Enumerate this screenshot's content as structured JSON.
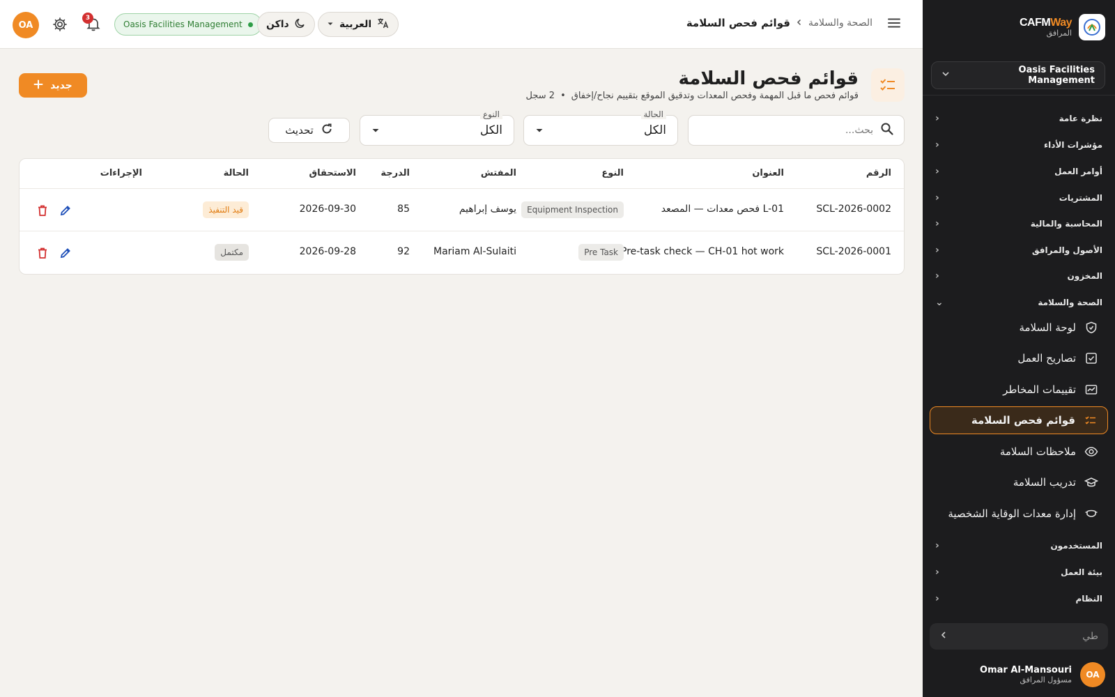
{
  "topbar": {
    "avatar_initials": "OA",
    "notif_count": "3",
    "org_name": "Oasis Facilities Management",
    "theme_label": "داكن",
    "language_label": "العربية",
    "breadcrumb_parent": "الصحة والسلامة",
    "breadcrumb_current": "قوائم فحص السلامة"
  },
  "sidebar": {
    "brand_main": "CAFM",
    "brand_accent": "Way",
    "brand_sub": "المرافق",
    "org_selector": "Oasis Facilities Management",
    "sections": [
      {
        "label": "نظرة عامة"
      },
      {
        "label": "مؤشرات الأداء"
      },
      {
        "label": "أوامر العمل"
      },
      {
        "label": "المشتريات"
      },
      {
        "label": "المحاسبة والمالية"
      },
      {
        "label": "الأصول والمرافق"
      },
      {
        "label": "المخزون"
      },
      {
        "label": "الصحة والسلامة"
      }
    ],
    "hse_items": [
      {
        "label": "لوحة السلامة",
        "icon": "shield-icon"
      },
      {
        "label": "تصاريح العمل",
        "icon": "checkbox-icon"
      },
      {
        "label": "تقييمات المخاطر",
        "icon": "chart-box-icon"
      },
      {
        "label": "قوائم فحص السلامة",
        "icon": "checklist-icon"
      },
      {
        "label": "ملاحظات السلامة",
        "icon": "eye-icon"
      },
      {
        "label": "تدريب السلامة",
        "icon": "graduation-cap-icon"
      },
      {
        "label": "إدارة معدات الوقاية الشخصية",
        "icon": "mask-icon"
      }
    ],
    "lower_sections": [
      {
        "label": "المستخدمون"
      },
      {
        "label": "بيئة العمل"
      },
      {
        "label": "النظام"
      }
    ],
    "search_placeholder": "طي",
    "user_name": "Omar Al-Mansouri",
    "user_role": "مسؤول المرافق",
    "user_initials": "OA"
  },
  "page": {
    "title": "قوائم فحص السلامة",
    "subtitle": "قوائم فحص ما قبل المهمة وفحص المعدات وتدقيق الموقع بتقييم نجاح/إخفاق",
    "record_count": "2 سجل",
    "new_button": "جديد"
  },
  "filters": {
    "search_placeholder": "بحث...",
    "status_label": "الحالة",
    "status_value": "الكل",
    "type_label": "النوع",
    "type_value": "الكل",
    "refresh_label": "تحديث"
  },
  "table": {
    "headers": {
      "number": "الرقم",
      "title": "العنوان",
      "type": "النوع",
      "inspector": "المفتش",
      "score": "الدرجة",
      "due": "الاستحقاق",
      "status": "الحالة",
      "actions": "الإجراءات"
    },
    "rows": [
      {
        "number": "SCL-2026-0002",
        "title": "فحص معدات — المصعد L-01",
        "type": "Equipment Inspection",
        "inspector": "يوسف إبراهيم",
        "score": "85",
        "due": "2026-09-30",
        "status": "قيد التنفيذ"
      },
      {
        "number": "SCL-2026-0001",
        "title": "Pre-task check — CH-01 hot work",
        "type": "Pre Task",
        "inspector": "Mariam Al-Sulaiti",
        "score": "92",
        "due": "2026-09-28",
        "status": "مكتمل"
      }
    ]
  },
  "colors": {
    "accent": "#f08a24",
    "sidebar_bg": "#1c1c1e",
    "page_bg": "#f4f2ee",
    "delete": "#d32f2f",
    "edit": "#1e4fb8"
  }
}
